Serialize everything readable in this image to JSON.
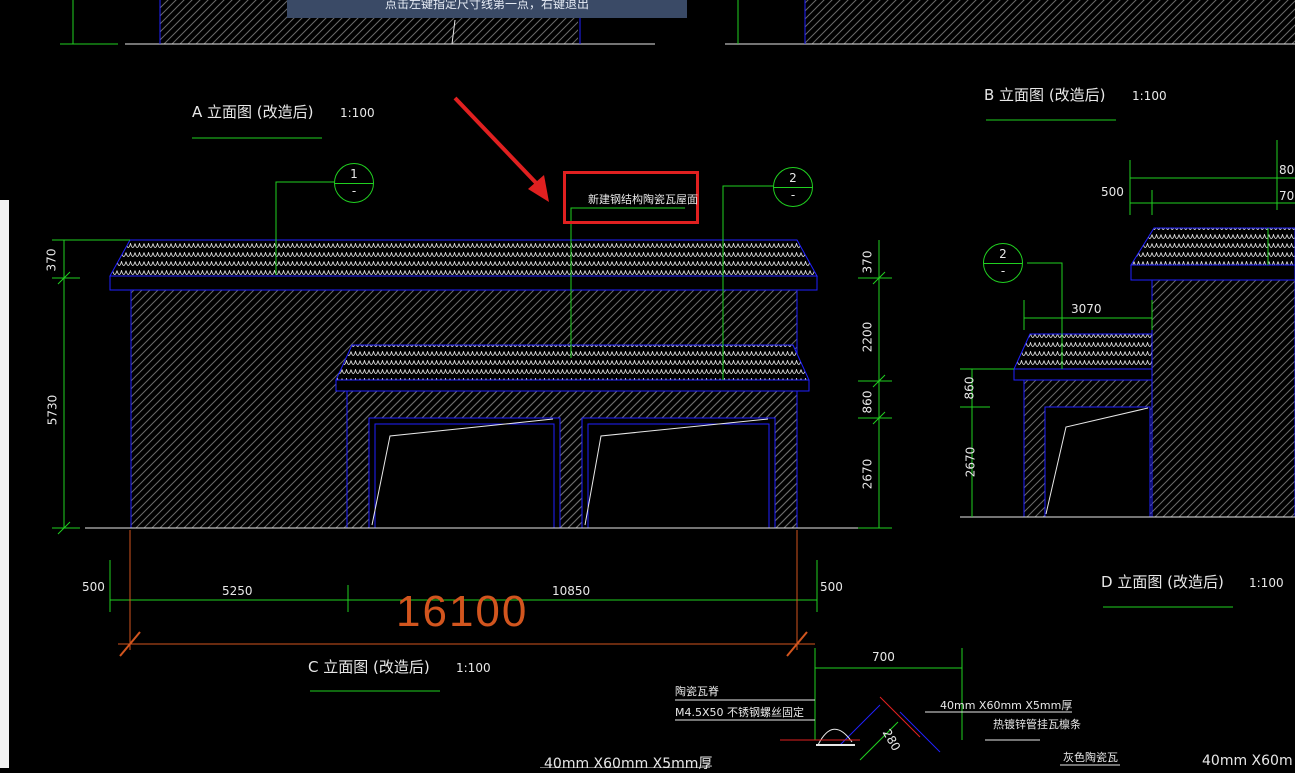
{
  "tooltip": "点击左键指定尺寸线第一点，右键退出",
  "views": {
    "a": {
      "title": "A 立面图 (改造后)",
      "scale": "1:100"
    },
    "b": {
      "title": "B 立面图 (改造后)",
      "scale": "1:100"
    },
    "c": {
      "title": "C 立面图 (改造后)",
      "scale": "1:100"
    },
    "d": {
      "title": "D 立面图 (改造后)",
      "scale": "1:100"
    }
  },
  "callout": {
    "text": "新建钢结构陶瓷瓦屋面"
  },
  "bubbles": [
    {
      "num": "1",
      "sub": "-"
    },
    {
      "num": "2",
      "sub": "-"
    },
    {
      "num": "2",
      "sub": "-"
    }
  ],
  "dims_left": {
    "top": "370",
    "main": "5730"
  },
  "dims_right": {
    "top": "370",
    "a": "2200",
    "b": "860",
    "c": "2670"
  },
  "dims_bottom": {
    "left": "500",
    "a": "5250",
    "b": "10850",
    "right": "500",
    "total": "16100"
  },
  "dims_b": {
    "d500": "500",
    "d80": "80",
    "d70": "70",
    "d3070": "3070",
    "d860": "860",
    "d2670": "2670"
  },
  "detail": {
    "d700": "700",
    "d280": "280",
    "note1": "陶瓷瓦脊",
    "note2": "M4.5X50 不锈钢螺丝固定",
    "note3": "40mm X60mm X5mm厚",
    "note4": "热镀锌管挂瓦檩条",
    "note5": "灰色陶瓷瓦",
    "note6": "40mm X60mm X5mm厚",
    "note7": "40mm X60m"
  },
  "colors": {
    "bg": "#000000",
    "outline": "#2020ff",
    "dim": "#20d020",
    "hatch": "#6a6a6a",
    "tile": "#d8d8d8",
    "red": "#e02020",
    "big": "#d2551e"
  }
}
